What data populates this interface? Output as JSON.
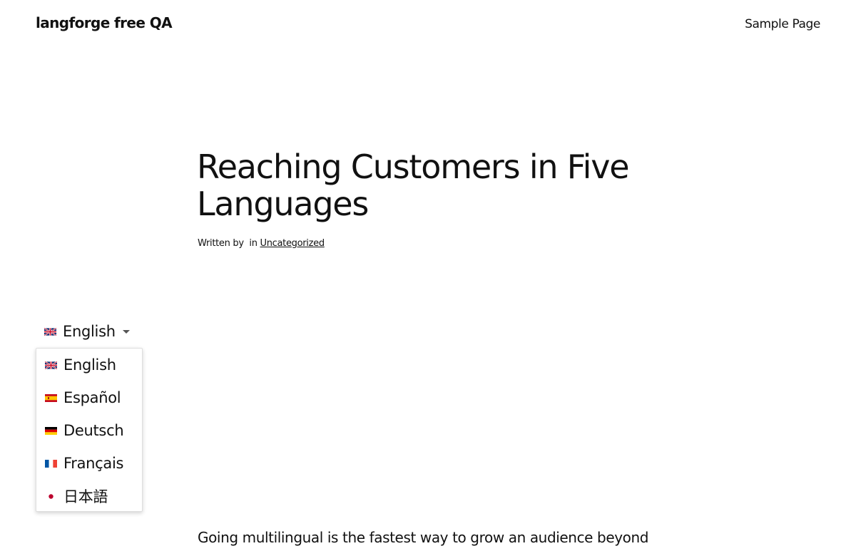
{
  "site": {
    "title": "langforge free QA"
  },
  "nav": {
    "items": [
      {
        "label": "Sample Page"
      }
    ]
  },
  "post": {
    "title": "Reaching Customers in Five Languages",
    "meta_prefix": "Written by  in ",
    "category": "Uncategorized",
    "body_visible": "Going multilingual is the fastest way to grow an audience beyond"
  },
  "language_switcher": {
    "current": {
      "label": "English",
      "flag_icon": "uk-flag-icon"
    },
    "items": [
      {
        "label": "English",
        "flag_icon": "uk-flag-icon"
      },
      {
        "label": "Español",
        "flag_icon": "spain-flag-icon"
      },
      {
        "label": "Deutsch",
        "flag_icon": "germany-flag-icon"
      },
      {
        "label": "Français",
        "flag_icon": "france-flag-icon"
      },
      {
        "label": "日本語",
        "flag_icon": "japan-flag-icon"
      }
    ]
  },
  "colors": {
    "text": "#111111",
    "background": "#ffffff",
    "menu_border": "#dedede"
  }
}
